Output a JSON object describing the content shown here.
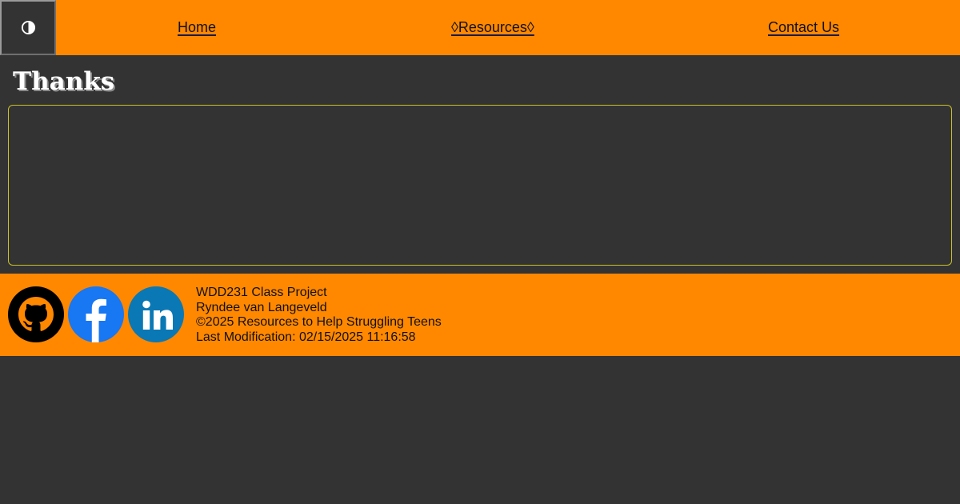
{
  "header": {
    "theme_toggle_icon": "half-moon-contrast-icon",
    "nav": {
      "home": "Home",
      "resources": "◊Resources◊",
      "contact": "Contact Us"
    }
  },
  "main": {
    "title": "Thanks"
  },
  "footer": {
    "social": [
      {
        "icon": "github-icon"
      },
      {
        "icon": "facebook-icon"
      },
      {
        "icon": "linkedin-icon"
      }
    ],
    "line1": "WDD231 Class Project",
    "line2": "Ryndee van Langeveld",
    "line3": "©2025 Resources to Help Struggling Teens",
    "last_modified": "Last Modification: 02/15/2025 11:16:58"
  },
  "colors": {
    "accent": "#ff8800",
    "background": "#333333",
    "content_border": "#c9c12a",
    "facebook": "#1877f2",
    "linkedin": "#0a78b4"
  }
}
